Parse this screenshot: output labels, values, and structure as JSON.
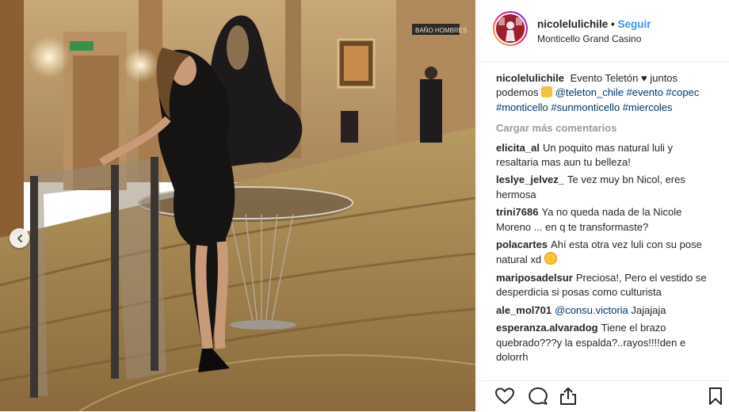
{
  "header": {
    "username": "nicolelulichile",
    "separator": "•",
    "follow_label": "Seguir",
    "location": "Monticello Grand Casino"
  },
  "photo": {
    "sign_text": "BAÑO HOMBRES"
  },
  "caption": {
    "user": "nicolelulichile",
    "text_part1": "Evento Teletón",
    "heart": "♥",
    "text_part2": "juntos podemos",
    "mention": "@teleton_chile",
    "hashtags": "#evento #copec #monticello #sunmonticello #miercoles"
  },
  "load_more": "Cargar más comentarios",
  "comments": [
    {
      "user": "elicita_al",
      "text": "Un poquito mas natural luli y resaltaria mas aun tu belleza!"
    },
    {
      "user": "leslye_jelvez_",
      "text": "Te vez muy bn Nicol, eres hermosa"
    },
    {
      "user": "trini7686",
      "text": "Ya no queda nada de la Nicole Moreno ... en q te transformaste?"
    },
    {
      "user": "polacartes",
      "text": "Ahí esta otra vez luli con su pose natural xd"
    },
    {
      "user": "mariposadelsur",
      "text": "Preciosa!, Pero el vestido se desperdicia si posas como culturista"
    },
    {
      "user": "ale_mol701",
      "mention": "@consu.victoria",
      "text": "Jajajaja"
    },
    {
      "user": "esperanza.alvaradog",
      "text": "Tiene el brazo quebrado???y la espalda?..rayos!!!!den e dolorrh"
    }
  ],
  "icons": {
    "prev": "chevron-left-icon",
    "like": "heart-icon",
    "comment": "comment-icon",
    "share": "share-icon",
    "save": "bookmark-icon"
  },
  "colors": {
    "link": "#003569",
    "follow": "#3897f0",
    "muted": "#999999"
  }
}
